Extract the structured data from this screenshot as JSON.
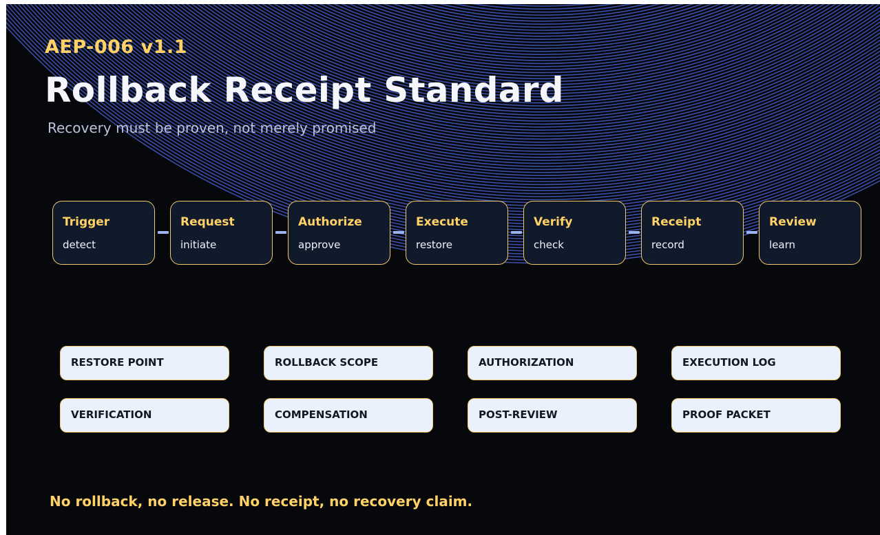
{
  "header": {
    "version": "AEP-006 v1.1",
    "title": "Rollback Receipt Standard",
    "subtitle": "Recovery must be proven, not merely promised"
  },
  "flow": {
    "steps": [
      {
        "name": "Trigger",
        "verb": "detect"
      },
      {
        "name": "Request",
        "verb": "initiate"
      },
      {
        "name": "Authorize",
        "verb": "approve"
      },
      {
        "name": "Execute",
        "verb": "restore"
      },
      {
        "name": "Verify",
        "verb": "check"
      },
      {
        "name": "Receipt",
        "verb": "record"
      },
      {
        "name": "Review",
        "verb": "learn"
      }
    ]
  },
  "components": {
    "items": [
      "RESTORE POINT",
      "ROLLBACK SCOPE",
      "AUTHORIZATION",
      "EXECUTION LOG",
      "VERIFICATION",
      "COMPENSATION",
      "POST-REVIEW",
      "PROOF PACKET"
    ]
  },
  "footer": {
    "text": "No rollback, no release. No receipt, no recovery claim."
  },
  "colors": {
    "background": "#07080c",
    "accent": "#ffd166",
    "ring": "#3a4fa8",
    "step_fill": "#111a2b",
    "tile_fill": "#eaf1fd",
    "connector": "#9bb4f0"
  }
}
